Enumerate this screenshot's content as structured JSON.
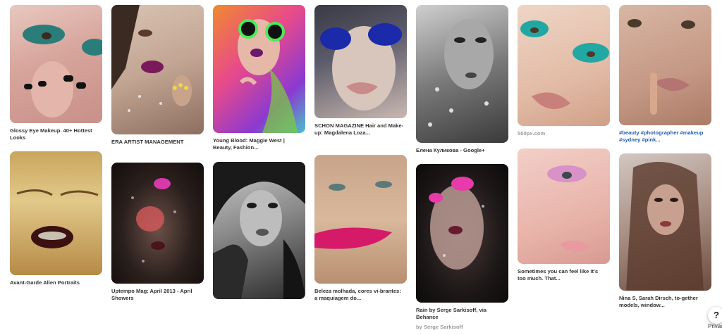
{
  "pins": [
    {
      "caption": "Glossy Eye Makeup. 40+ Hottest Looks"
    },
    {
      "caption": "ERA ARTIST MANAGEMENT"
    },
    {
      "caption": "Young Blood: Maggie West | Beauty, Fashion..."
    },
    {
      "caption": "SCHON MAGAZINE Hair and Make-up: Magdalena Loza..."
    },
    {
      "caption": "Елена Куликова - Google+"
    },
    {
      "caption": "500px.com"
    },
    {
      "caption": "#beauty #photographer #makeup #sydney #pink..."
    },
    {
      "caption": "Avant-Garde Alien Portraits"
    },
    {
      "caption": "Uptempo Mag: April 2013 - April Showers"
    },
    {
      "caption": ""
    },
    {
      "caption": "Beleza molhada, cores vi-brantes: a maquiagem do..."
    },
    {
      "caption": "Rain by Serge Sarkisoff, via Behance",
      "sub": "by Serge Sarkisoff"
    },
    {
      "caption": "Sometimes you can feel like it's too much. That..."
    },
    {
      "caption": "Nina S, Sarah Dirsch, to-gether models, window..."
    }
  ],
  "help_label": "?",
  "privacy_label": "Privac"
}
